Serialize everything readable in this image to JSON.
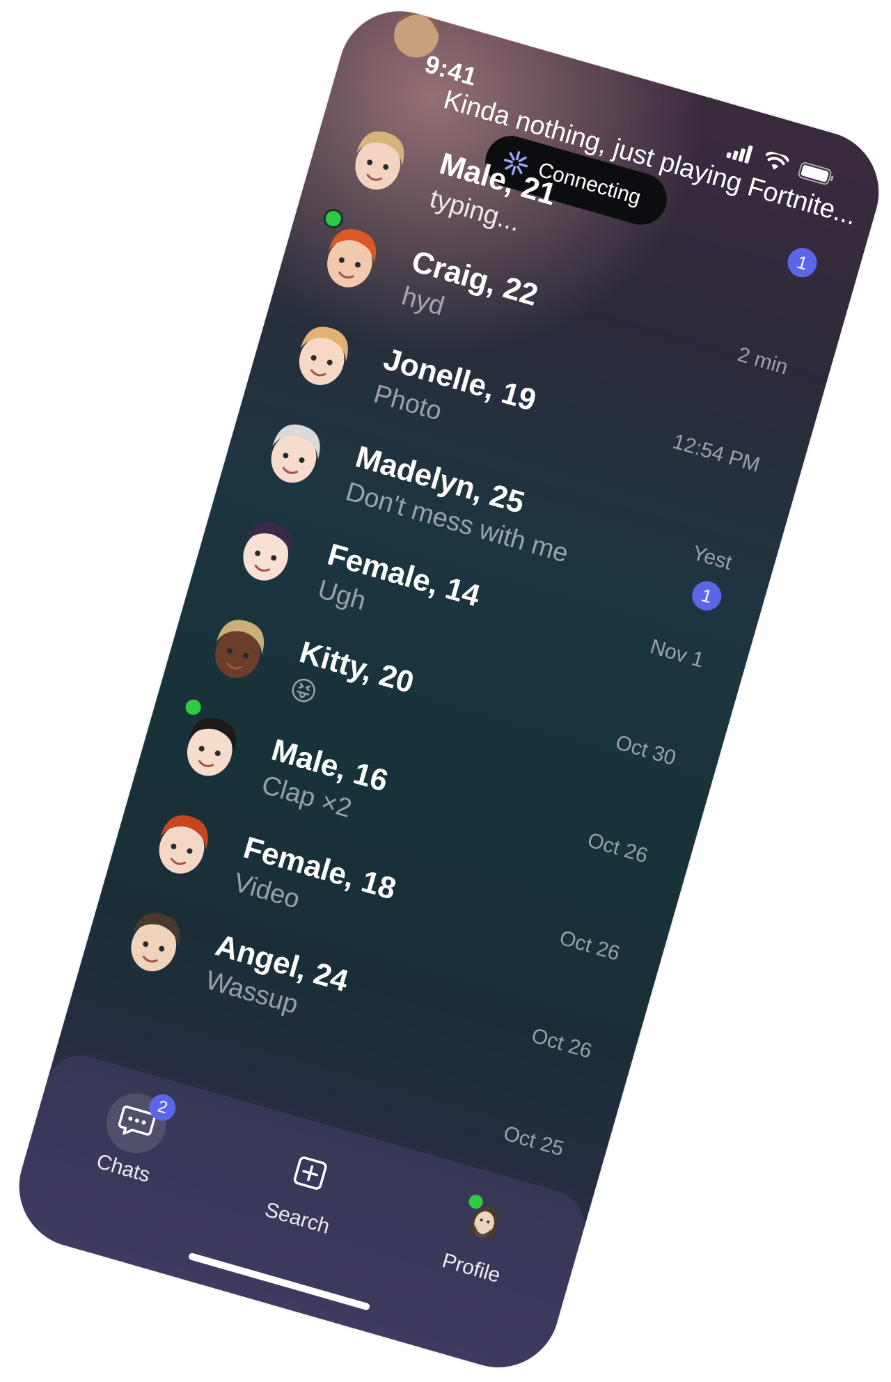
{
  "status_bar": {
    "time": "9:41"
  },
  "connecting": {
    "label": "Connecting"
  },
  "top_partial": {
    "preview": "Kinda nothing, just playing Fortnite...",
    "badge": "1"
  },
  "chats": [
    {
      "name": "Male, 21",
      "preview": "typing...",
      "time": "",
      "badge": "",
      "online": false,
      "skin": "#f3d4c2",
      "hair": "#d6b57d"
    },
    {
      "name": "Craig, 22",
      "preview": "hyd",
      "time": "2 min",
      "badge": "",
      "online": true,
      "skin": "#f2c9ac",
      "hair": "#d95a24"
    },
    {
      "name": "Jonelle, 19",
      "preview": "Photo",
      "time": "12:54 PM",
      "badge": "",
      "online": false,
      "skin": "#f6d8c4",
      "hair": "#e1b273"
    },
    {
      "name": "Madelyn, 25",
      "preview": "Don't mess with me",
      "time": "Yest",
      "badge": "1",
      "online": false,
      "skin": "#f7dccd",
      "hair": "#d9d9d9"
    },
    {
      "name": "Female, 14",
      "preview": "Ugh",
      "time": "Nov 1",
      "badge": "",
      "online": false,
      "skin": "#f8e0d2",
      "hair": "#3a2a4a"
    },
    {
      "name": "Kitty, 20",
      "preview": "😝",
      "time": "Oct 30",
      "badge": "",
      "online": false,
      "skin": "#6a3e2a",
      "hair": "#c9b07a"
    },
    {
      "name": "Male, 16",
      "preview": "Clap ×2",
      "time": "Oct 26",
      "badge": "",
      "online": true,
      "skin": "#f6dccb",
      "hair": "#1e1a1a"
    },
    {
      "name": "Female, 18",
      "preview": "Video",
      "time": "Oct 26",
      "badge": "",
      "online": false,
      "skin": "#f5d7c5",
      "hair": "#c6471f"
    },
    {
      "name": "Angel, 24",
      "preview": "Wassup",
      "time": "Oct 26",
      "badge": "",
      "online": false,
      "skin": "#f0d3bd",
      "hair": "#4a3a2e"
    },
    {
      "name": "",
      "preview": "",
      "time": "Oct 25",
      "badge": "",
      "online": false,
      "skin": "",
      "hair": ""
    }
  ],
  "tabs": [
    {
      "label": "Chats",
      "badge": "2",
      "icon": "chat-bubble-icon",
      "active": true
    },
    {
      "label": "Search",
      "badge": "",
      "icon": "plus-square-icon",
      "active": false
    },
    {
      "label": "Profile",
      "badge": "",
      "icon": "profile-avatar-icon",
      "active": false
    }
  ],
  "colors": {
    "accent": "#5b67e8",
    "online": "#2ecc40"
  }
}
